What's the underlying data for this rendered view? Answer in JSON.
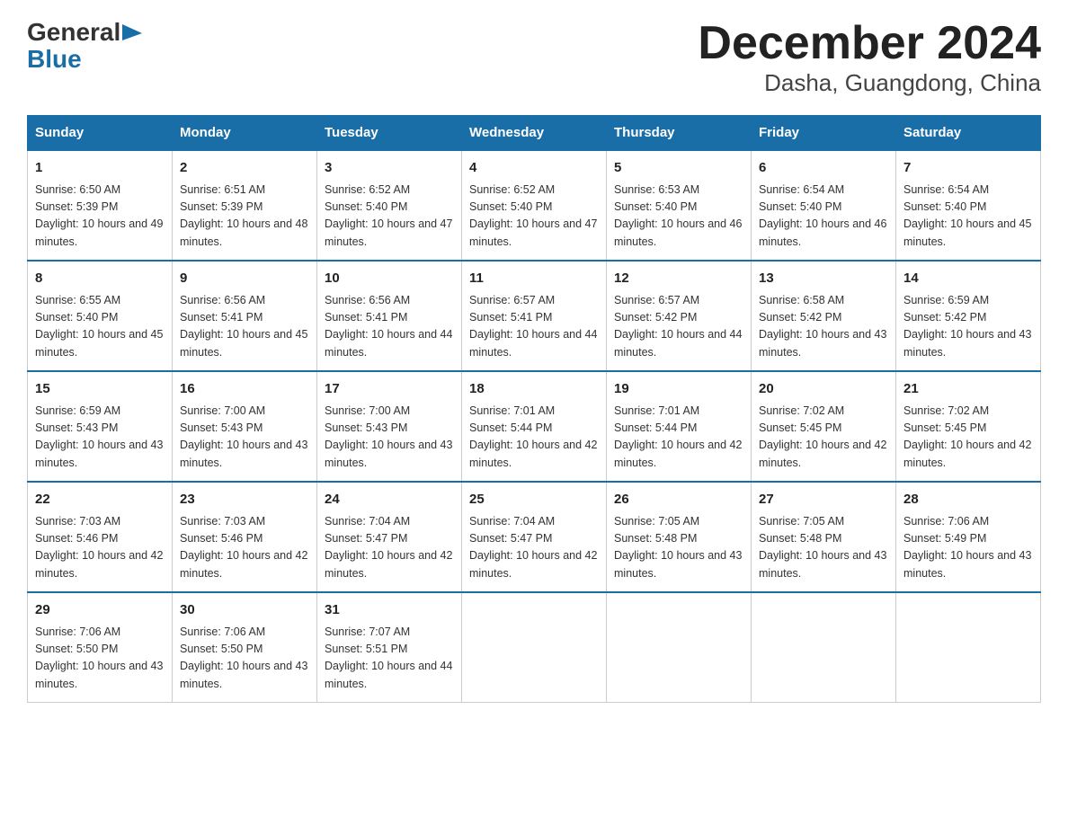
{
  "logo": {
    "general": "General",
    "blue": "Blue",
    "arrow": "▶"
  },
  "title": "December 2024",
  "subtitle": "Dasha, Guangdong, China",
  "days_of_week": [
    "Sunday",
    "Monday",
    "Tuesday",
    "Wednesday",
    "Thursday",
    "Friday",
    "Saturday"
  ],
  "weeks": [
    [
      {
        "day": "1",
        "sunrise": "6:50 AM",
        "sunset": "5:39 PM",
        "daylight": "10 hours and 49 minutes."
      },
      {
        "day": "2",
        "sunrise": "6:51 AM",
        "sunset": "5:39 PM",
        "daylight": "10 hours and 48 minutes."
      },
      {
        "day": "3",
        "sunrise": "6:52 AM",
        "sunset": "5:40 PM",
        "daylight": "10 hours and 47 minutes."
      },
      {
        "day": "4",
        "sunrise": "6:52 AM",
        "sunset": "5:40 PM",
        "daylight": "10 hours and 47 minutes."
      },
      {
        "day": "5",
        "sunrise": "6:53 AM",
        "sunset": "5:40 PM",
        "daylight": "10 hours and 46 minutes."
      },
      {
        "day": "6",
        "sunrise": "6:54 AM",
        "sunset": "5:40 PM",
        "daylight": "10 hours and 46 minutes."
      },
      {
        "day": "7",
        "sunrise": "6:54 AM",
        "sunset": "5:40 PM",
        "daylight": "10 hours and 45 minutes."
      }
    ],
    [
      {
        "day": "8",
        "sunrise": "6:55 AM",
        "sunset": "5:40 PM",
        "daylight": "10 hours and 45 minutes."
      },
      {
        "day": "9",
        "sunrise": "6:56 AM",
        "sunset": "5:41 PM",
        "daylight": "10 hours and 45 minutes."
      },
      {
        "day": "10",
        "sunrise": "6:56 AM",
        "sunset": "5:41 PM",
        "daylight": "10 hours and 44 minutes."
      },
      {
        "day": "11",
        "sunrise": "6:57 AM",
        "sunset": "5:41 PM",
        "daylight": "10 hours and 44 minutes."
      },
      {
        "day": "12",
        "sunrise": "6:57 AM",
        "sunset": "5:42 PM",
        "daylight": "10 hours and 44 minutes."
      },
      {
        "day": "13",
        "sunrise": "6:58 AM",
        "sunset": "5:42 PM",
        "daylight": "10 hours and 43 minutes."
      },
      {
        "day": "14",
        "sunrise": "6:59 AM",
        "sunset": "5:42 PM",
        "daylight": "10 hours and 43 minutes."
      }
    ],
    [
      {
        "day": "15",
        "sunrise": "6:59 AM",
        "sunset": "5:43 PM",
        "daylight": "10 hours and 43 minutes."
      },
      {
        "day": "16",
        "sunrise": "7:00 AM",
        "sunset": "5:43 PM",
        "daylight": "10 hours and 43 minutes."
      },
      {
        "day": "17",
        "sunrise": "7:00 AM",
        "sunset": "5:43 PM",
        "daylight": "10 hours and 43 minutes."
      },
      {
        "day": "18",
        "sunrise": "7:01 AM",
        "sunset": "5:44 PM",
        "daylight": "10 hours and 42 minutes."
      },
      {
        "day": "19",
        "sunrise": "7:01 AM",
        "sunset": "5:44 PM",
        "daylight": "10 hours and 42 minutes."
      },
      {
        "day": "20",
        "sunrise": "7:02 AM",
        "sunset": "5:45 PM",
        "daylight": "10 hours and 42 minutes."
      },
      {
        "day": "21",
        "sunrise": "7:02 AM",
        "sunset": "5:45 PM",
        "daylight": "10 hours and 42 minutes."
      }
    ],
    [
      {
        "day": "22",
        "sunrise": "7:03 AM",
        "sunset": "5:46 PM",
        "daylight": "10 hours and 42 minutes."
      },
      {
        "day": "23",
        "sunrise": "7:03 AM",
        "sunset": "5:46 PM",
        "daylight": "10 hours and 42 minutes."
      },
      {
        "day": "24",
        "sunrise": "7:04 AM",
        "sunset": "5:47 PM",
        "daylight": "10 hours and 42 minutes."
      },
      {
        "day": "25",
        "sunrise": "7:04 AM",
        "sunset": "5:47 PM",
        "daylight": "10 hours and 42 minutes."
      },
      {
        "day": "26",
        "sunrise": "7:05 AM",
        "sunset": "5:48 PM",
        "daylight": "10 hours and 43 minutes."
      },
      {
        "day": "27",
        "sunrise": "7:05 AM",
        "sunset": "5:48 PM",
        "daylight": "10 hours and 43 minutes."
      },
      {
        "day": "28",
        "sunrise": "7:06 AM",
        "sunset": "5:49 PM",
        "daylight": "10 hours and 43 minutes."
      }
    ],
    [
      {
        "day": "29",
        "sunrise": "7:06 AM",
        "sunset": "5:50 PM",
        "daylight": "10 hours and 43 minutes."
      },
      {
        "day": "30",
        "sunrise": "7:06 AM",
        "sunset": "5:50 PM",
        "daylight": "10 hours and 43 minutes."
      },
      {
        "day": "31",
        "sunrise": "7:07 AM",
        "sunset": "5:51 PM",
        "daylight": "10 hours and 44 minutes."
      },
      null,
      null,
      null,
      null
    ]
  ]
}
